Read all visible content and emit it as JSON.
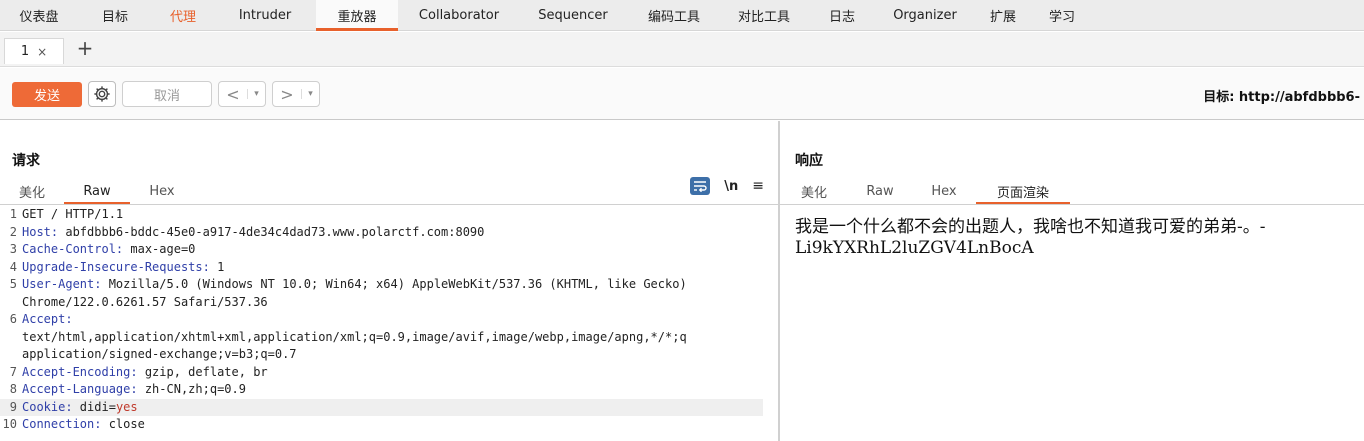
{
  "menubar": {
    "items": [
      {
        "label": "仪表盘",
        "w": 78
      },
      {
        "label": "目标",
        "w": 74
      },
      {
        "label": "代理",
        "w": 62,
        "orange": true
      },
      {
        "label": "Intruder",
        "w": 102
      },
      {
        "label": "重放器",
        "w": 82,
        "active": true
      },
      {
        "label": "Collaborator",
        "w": 122
      },
      {
        "label": "Sequencer",
        "w": 106
      },
      {
        "label": "编码工具",
        "w": 96
      },
      {
        "label": "对比工具",
        "w": 84
      },
      {
        "label": "日志",
        "w": 72
      },
      {
        "label": "Organizer",
        "w": 94
      },
      {
        "label": "扩展",
        "w": 62
      },
      {
        "label": "学习",
        "w": 56
      }
    ]
  },
  "tabs": {
    "tab1": "1",
    "close": "×",
    "add": "+"
  },
  "toolbar": {
    "send": "发送",
    "cancel": "取消",
    "prev": "<",
    "next": ">",
    "dropdown": "▾",
    "target": "目标: http://abfdbbb6-"
  },
  "request": {
    "title": "请求",
    "tabs": [
      "美化",
      "Raw",
      "Hex"
    ],
    "active_tab": "Raw",
    "nl_label": "\\n",
    "menu_label": "≡",
    "lines": [
      {
        "n": "1",
        "key": "",
        "val": "GET / HTTP/1.1"
      },
      {
        "n": "2",
        "key": "Host:",
        "val": " abfdbbb6-bddc-45e0-a917-4de34c4dad73.www.polarctf.com:8090"
      },
      {
        "n": "3",
        "key": "Cache-Control:",
        "val": " max-age=0"
      },
      {
        "n": "4",
        "key": "Upgrade-Insecure-Requests:",
        "val": " 1"
      },
      {
        "n": "5",
        "key": "User-Agent:",
        "val": " Mozilla/5.0 (Windows NT 10.0; Win64; x64) AppleWebKit/537.36 (KHTML, like Gecko)"
      },
      {
        "n": "",
        "key": "",
        "val": "Chrome/122.0.6261.57 Safari/537.36"
      },
      {
        "n": "6",
        "key": "Accept:",
        "val": ""
      },
      {
        "n": "",
        "key": "",
        "val": "text/html,application/xhtml+xml,application/xml;q=0.9,image/avif,image/webp,image/apng,*/*;q"
      },
      {
        "n": "",
        "key": "",
        "val": "application/signed-exchange;v=b3;q=0.7"
      },
      {
        "n": "7",
        "key": "Accept-Encoding:",
        "val": " gzip, deflate, br"
      },
      {
        "n": "8",
        "key": "Accept-Language:",
        "val": " zh-CN,zh;q=0.9"
      },
      {
        "n": "9",
        "key": "Cookie:",
        "val": " didi=",
        "extra": "yes",
        "hl": true
      },
      {
        "n": "10",
        "key": "Connection:",
        "val": " close"
      }
    ]
  },
  "response": {
    "title": "响应",
    "tabs": [
      "美化",
      "Raw",
      "Hex",
      "页面渲染"
    ],
    "active_tab": "页面渲染",
    "rendered_text": "我是一个什么都不会的出题人，我啥也不知道我可爱的弟弟-。-Li9kYXRhL2luZGV4LnBocA"
  },
  "colors": {
    "accent": "#e8612c",
    "send": "#ee6a37",
    "key": "#2f3fa8"
  }
}
